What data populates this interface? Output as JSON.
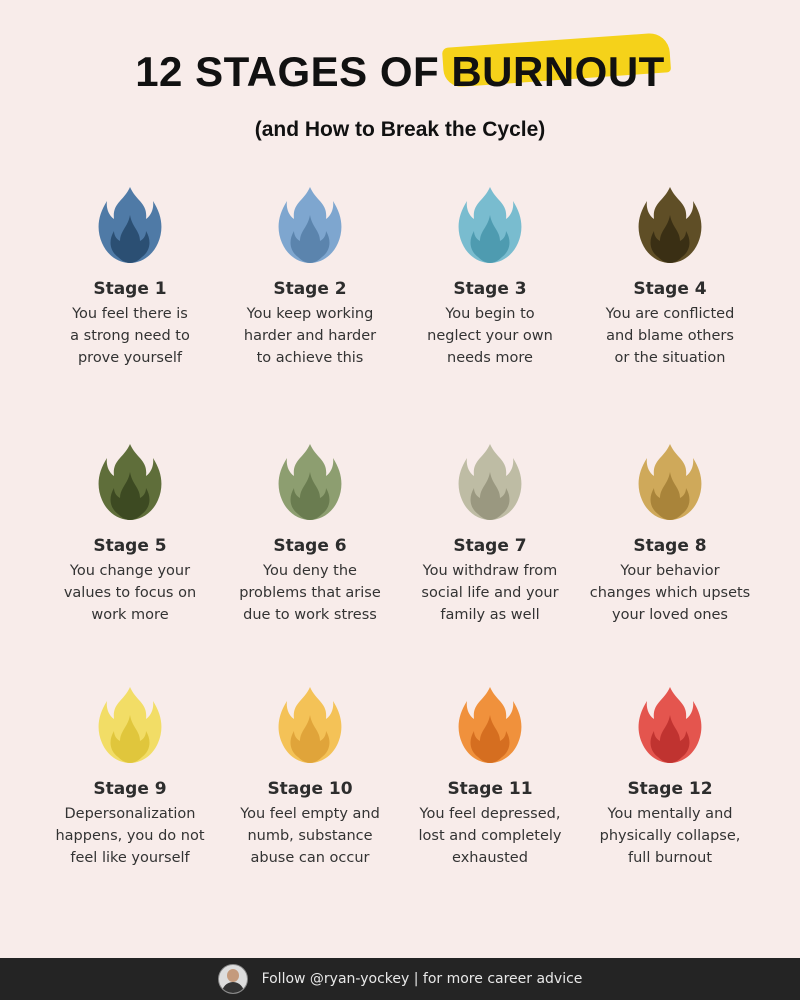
{
  "title": {
    "pre": "12 STAGES OF ",
    "highlight": "BURNOUT"
  },
  "subtitle": "(and How to Break the Cycle)",
  "stages": [
    {
      "label": "Stage 1",
      "desc": "You feel there is\na strong need to\nprove yourself",
      "color": "#4f7aa6",
      "dark": "#2b4f73"
    },
    {
      "label": "Stage 2",
      "desc": "You keep working\nharder and harder\nto achieve this",
      "color": "#7ea6cf",
      "dark": "#5b84ad"
    },
    {
      "label": "Stage 3",
      "desc": "You begin to\nneglect your own\nneeds more",
      "color": "#79bccf",
      "dark": "#4e9bb0"
    },
    {
      "label": "Stage 4",
      "desc": "You are conflicted\nand blame others\nor the situation",
      "color": "#5f4e26",
      "dark": "#3a2f14"
    },
    {
      "label": "Stage 5",
      "desc": "You change your\nvalues to focus on\nwork more",
      "color": "#5f6e3a",
      "dark": "#3d4a22"
    },
    {
      "label": "Stage 6",
      "desc": "You deny the\nproblems that arise\ndue to work stress",
      "color": "#8d9e70",
      "dark": "#6a7c50"
    },
    {
      "label": "Stage 7",
      "desc": "You withdraw from\nsocial life and your\nfamily as well",
      "color": "#bebca4",
      "dark": "#9a9880"
    },
    {
      "label": "Stage 8",
      "desc": "Your behavior\nchanges which upsets\nyour loved ones",
      "color": "#cfa95a",
      "dark": "#a9843a"
    },
    {
      "label": "Stage 9",
      "desc": "Depersonalization\nhappens, you do not\nfeel like yourself",
      "color": "#f2dd66",
      "dark": "#e0c63c"
    },
    {
      "label": "Stage 10",
      "desc": "You feel empty and\nnumb, substance\nabuse can occur",
      "color": "#f4c257",
      "dark": "#e0a43a"
    },
    {
      "label": "Stage 11",
      "desc": "You feel depressed,\nlost and completely\nexhausted",
      "color": "#f0913c",
      "dark": "#d56e20"
    },
    {
      "label": "Stage 12",
      "desc": "You mentally and\nphysically collapse,\nfull burnout",
      "color": "#e4554e",
      "dark": "#c03330"
    }
  ],
  "footer": {
    "text": "Follow @ryan-yockey | for more career advice"
  },
  "icons": {
    "flame": "flame-icon",
    "avatar": "avatar"
  }
}
